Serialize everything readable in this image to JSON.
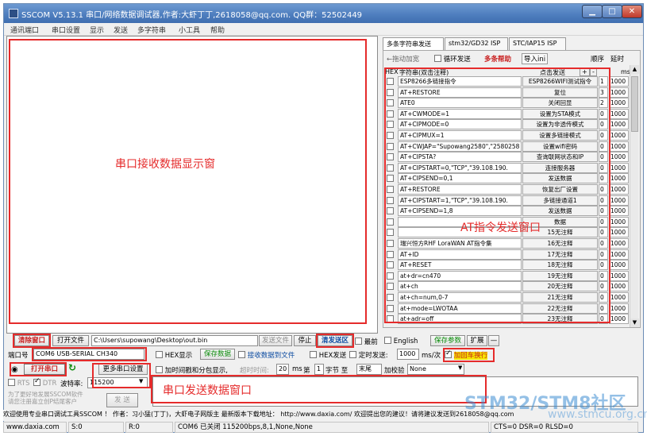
{
  "window": {
    "title": "SSCOM V5.13.1 串口/网络数据调试器,作者:大虾丁丁,2618058@qq.com. QQ群：52502449",
    "min_label": "▁",
    "max_label": "□",
    "close_label": "✕"
  },
  "menu": [
    "通讯端口",
    "串口设置",
    "显示",
    "发送",
    "多字符串",
    "小工具",
    "帮助"
  ],
  "receive": {
    "annotation": "串口接收数据显示窗"
  },
  "tabs": [
    "多条字符串发送",
    "stm32/GD32 ISP",
    "STC/IAP15 ISP"
  ],
  "multi": {
    "toolbar": {
      "drag_add": "←拖动加宽",
      "loop_send": "循环发送",
      "help": "多条帮助",
      "import": "导入ini",
      "order": "顺序",
      "delay": "延时"
    },
    "headers": {
      "hex": "HEX",
      "string": "字符串(双击注释)",
      "click_send": "点击发送",
      "plus": "+",
      "minus": "-",
      "ms": "ms"
    },
    "annotation": "AT指令发送窗口",
    "rows": [
      {
        "cmd": "ESP8266多链接指令",
        "btn": "ESP8266WIFI测试指令",
        "order": "1",
        "delay": "1000"
      },
      {
        "cmd": "AT+RESTORE",
        "btn": "复位",
        "order": "3",
        "delay": "1000"
      },
      {
        "cmd": "ATE0",
        "btn": "关闭回显",
        "order": "2",
        "delay": "1000"
      },
      {
        "cmd": "AT+CWMODE=1",
        "btn": "设置为STA模式",
        "order": "0",
        "delay": "1000"
      },
      {
        "cmd": "AT+CIPMODE=0",
        "btn": "设置为非透传模式",
        "order": "0",
        "delay": "1000"
      },
      {
        "cmd": "AT+CIPMUX=1",
        "btn": "设置多链接模式",
        "order": "0",
        "delay": "1000"
      },
      {
        "cmd": "AT+CWJAP=\"Supowang2580\",\"2580258",
        "btn": "设置wifi密码",
        "order": "0",
        "delay": "1000"
      },
      {
        "cmd": "AT+CIPSTA?",
        "btn": "查询联网状态和IP",
        "order": "0",
        "delay": "1000"
      },
      {
        "cmd": "AT+CIPSTART=0,\"TCP\",\"39.108.190.",
        "btn": "连接服务器",
        "order": "0",
        "delay": "1000"
      },
      {
        "cmd": "AT+CIPSEND=0,1",
        "btn": "发送数据",
        "order": "0",
        "delay": "1000"
      },
      {
        "cmd": "AT+RESTORE",
        "btn": "恢复出厂设置",
        "order": "0",
        "delay": "1000"
      },
      {
        "cmd": "AT+CIPSTART=1,\"TCP\",\"39.108.190.",
        "btn": "多链接通道1",
        "order": "0",
        "delay": "1000"
      },
      {
        "cmd": "AT+CIPSEND=1,8",
        "btn": "发送数据",
        "order": "0",
        "delay": "1000"
      },
      {
        "cmd": "",
        "btn": "数据",
        "order": "0",
        "delay": "1000"
      },
      {
        "cmd": "",
        "btn": "15无注释",
        "order": "0",
        "delay": "1000"
      },
      {
        "cmd": "瑞兴恒方RHF LoraWAN AT指令集",
        "btn": "16无注释",
        "order": "0",
        "delay": "1000"
      },
      {
        "cmd": "AT+ID",
        "btn": "17无注释",
        "order": "0",
        "delay": "1000"
      },
      {
        "cmd": "AT+RESET",
        "btn": "18无注释",
        "order": "0",
        "delay": "1000"
      },
      {
        "cmd": "at+dr=cn470",
        "btn": "19无注释",
        "order": "0",
        "delay": "1000"
      },
      {
        "cmd": "at+ch",
        "btn": "20无注释",
        "order": "0",
        "delay": "1000"
      },
      {
        "cmd": "at+ch=num,0-7",
        "btn": "21无注释",
        "order": "0",
        "delay": "1000"
      },
      {
        "cmd": "at+mode=LWOTAA",
        "btn": "22无注释",
        "order": "0",
        "delay": "1000"
      },
      {
        "cmd": "at+adr=off",
        "btn": "23无注释",
        "order": "0",
        "delay": "1000"
      }
    ]
  },
  "controls": {
    "clear_window": "清除窗口",
    "open_file": "打开文件",
    "file_path": "C:\\Users\\supowang\\Desktop\\out.bin",
    "send_file": "发送文件",
    "stop": "停止",
    "clear_send": "清发送区",
    "topmost": "最前",
    "english": "English",
    "save_params": "保存参数",
    "expand": "扩展",
    "dash": "—",
    "port_label": "端口号",
    "port_value": "COM6 USB-SERIAL CH340",
    "hex_display": "HEX显示",
    "save_data": "保存数据",
    "recv_to_file": "接收数据到文件",
    "hex_send": "HEX发送",
    "timed_send": "定时发送:",
    "timed_value": "1000",
    "timed_unit": "ms/次",
    "add_crlf": "加回车换行",
    "open_port": "打开串口",
    "more_settings": "更多串口设置",
    "add_timestamp": "加时间戳和分包显示,",
    "timeout_label": "超时时间:",
    "timeout_value": "20",
    "ms_label": "ms",
    "byte_label": "第",
    "byte_value": "1",
    "byte_suffix": "字节 至",
    "end_value": "末尾",
    "checksum_label": "加校验",
    "checksum_value": "None",
    "rts": "RTS",
    "dtr": "DTR",
    "baud_label": "波特率:",
    "baud_value": "115200",
    "promo": "为了更好地发展SSCOM软件\n请您注册嘉立创P结尾客户",
    "send": "发 送",
    "send_annotation": "串口发送数据窗口"
  },
  "footer": {
    "line": "欢迎使用专业串口调试工具SSCOM ！  作者：习小猛(丁丁)，大虾电子网版主  最新版本下载地址： http://www.daxia.com/  欢迎提出您的建议！请将建议发送到2618058@qq.com",
    "site": "www.daxia.com",
    "s": "S:0",
    "r": "R:0",
    "port_status": "COM6 已关闭  115200bps,8,1,None,None",
    "lines": "CTS=0 DSR=0 RLSD=0"
  },
  "watermark": {
    "main": "STM32/STM8社区",
    "sub": "www.stmcu.org.cn"
  },
  "colors": {
    "annotation": "#e52b2b",
    "accent_green": "#0a8a0a",
    "accent_red": "#c81e1e"
  }
}
